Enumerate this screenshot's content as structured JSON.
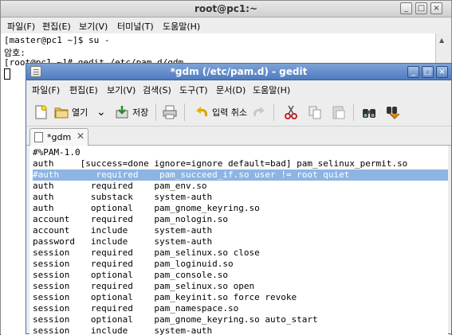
{
  "terminal": {
    "title": "root@pc1:~",
    "window_buttons": [
      "_",
      "□",
      "×"
    ],
    "menu": [
      "파일(F)",
      "편집(E)",
      "보기(V)",
      "터미널(T)",
      "도움말(H)"
    ],
    "lines": [
      "[master@pc1 ~]$ su -",
      "암호:",
      "[root@pc1 ~]# gedit /etc/pam.d/gdm"
    ]
  },
  "gedit": {
    "title": "*gdm (/etc/pam.d) - gedit",
    "window_buttons": [
      "_",
      "□",
      "×"
    ],
    "menu": [
      "파일(F)",
      "편집(E)",
      "보기(V)",
      "검색(S)",
      "도구(T)",
      "문서(D)",
      "도움말(H)"
    ],
    "toolbar": {
      "open_label": "열기",
      "save_label": "저장",
      "undo_label": "입력 취소"
    },
    "tab_label": "*gdm",
    "tab_close": "✕",
    "lines": [
      "#%PAM-1.0",
      "auth     [success=done ignore=ignore default=bad] pam_selinux_permit.so",
      "#auth       required    pam_succeed_if.so user != root quiet",
      "auth       required    pam_env.so",
      "auth       substack    system-auth",
      "auth       optional    pam_gnome_keyring.so",
      "account    required    pam_nologin.so",
      "account    include     system-auth",
      "password   include     system-auth",
      "session    required    pam_selinux.so close",
      "session    required    pam_loginuid.so",
      "session    optional    pam_console.so",
      "session    required    pam_selinux.so open",
      "session    optional    pam_keyinit.so force revoke",
      "session    required    pam_namespace.so",
      "session    optional    pam_gnome_keyring.so auto_start",
      "session    include     system-auth"
    ],
    "highlight_color": "#8db4e2"
  }
}
